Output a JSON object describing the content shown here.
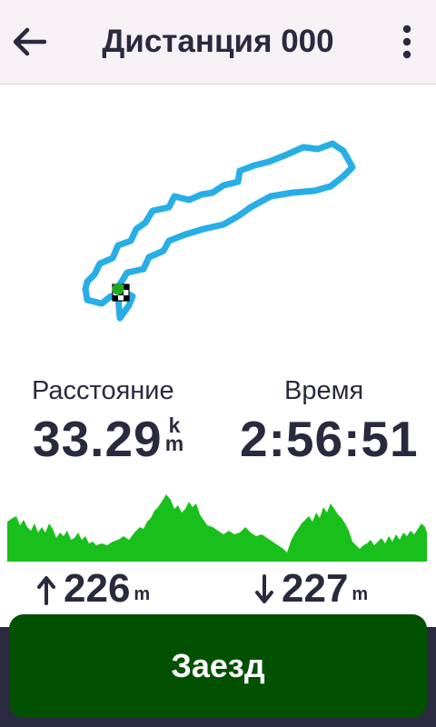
{
  "header": {
    "title": "Дистанция 000",
    "back_icon": "arrow-left-icon",
    "menu_icon": "vertical-dots-icon"
  },
  "colors": {
    "route": "#27aee6",
    "elevation_fill": "#19c01c",
    "start_marker": "#1fa91f",
    "text": "#2a2a3e",
    "header_bg": "#f6f1f5",
    "button_bg": "#015101",
    "bottom_bar": "#2a2a40"
  },
  "stats": {
    "distance_label": "Расстояние",
    "distance_value": "33.29",
    "distance_unit_top": "k",
    "distance_unit_bottom": "m",
    "time_label": "Время",
    "time_value": "2:56:51"
  },
  "elevation": {
    "ascent_value": "226",
    "ascent_unit": "m",
    "ascent_icon": "arrow-up-icon",
    "descent_value": "227",
    "descent_unit": "m",
    "descent_icon": "arrow-down-icon"
  },
  "action": {
    "ride_label": "Заезд"
  }
}
